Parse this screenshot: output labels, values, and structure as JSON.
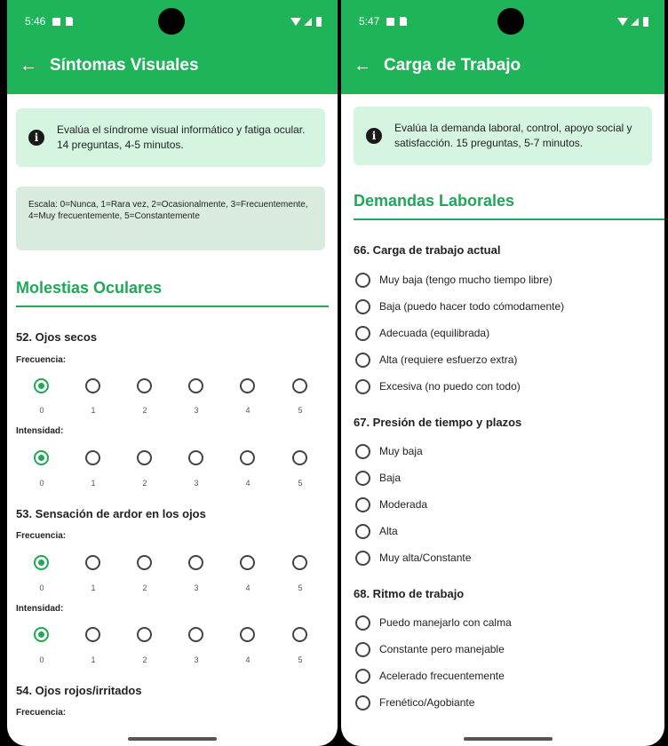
{
  "left": {
    "status_time": "5:46",
    "title": "Síntomas Visuales",
    "info": "Evalúa el síndrome visual informático y fatiga ocular. 14 preguntas, 4-5 minutos.",
    "scale": "Escala: 0=Nunca, 1=Rara vez, 2=Ocasionalmente, 3=Frecuentemente, 4=Muy frecuentemente, 5=Constantemente",
    "section": "Molestias Oculares",
    "freq_label": "Frecuencia:",
    "int_label": "Intensidad:",
    "scale_values": [
      "0",
      "1",
      "2",
      "3",
      "4",
      "5"
    ],
    "questions": [
      {
        "title": "52. Ojos secos",
        "freq_selected": 0,
        "int_selected": 0
      },
      {
        "title": "53. Sensación de ardor en los ojos",
        "freq_selected": 0,
        "int_selected": 0
      },
      {
        "title": "54. Ojos rojos/irritados"
      }
    ]
  },
  "right": {
    "status_time": "5:47",
    "title": "Carga de Trabajo",
    "info": "Evalúa la demanda laboral, control, apoyo social y satisfacción. 15 preguntas, 5-7 minutos.",
    "section": "Demandas Laborales",
    "questions": [
      {
        "title": "66. Carga de trabajo actual",
        "options": [
          "Muy baja (tengo mucho tiempo libre)",
          "Baja (puedo hacer todo cómodamente)",
          "Adecuada (equilibrada)",
          "Alta (requiere esfuerzo extra)",
          "Excesiva (no puedo con todo)"
        ]
      },
      {
        "title": "67. Presión de tiempo y plazos",
        "options": [
          "Muy baja",
          "Baja",
          "Moderada",
          "Alta",
          "Muy alta/Constante"
        ]
      },
      {
        "title": "68. Ritmo de trabajo",
        "options": [
          "Puedo manejarlo con calma",
          "Constante pero manejable",
          "Acelerado frecuentemente",
          "Frenético/Agobiante"
        ]
      }
    ]
  },
  "colors": {
    "primary": "#1fb35a",
    "accent": "#1fa857",
    "info_bg": "#d6f5e1",
    "scale_bg": "#d9ecdf"
  },
  "icons": {
    "back": "arrow-left-icon",
    "info": "info-icon"
  }
}
